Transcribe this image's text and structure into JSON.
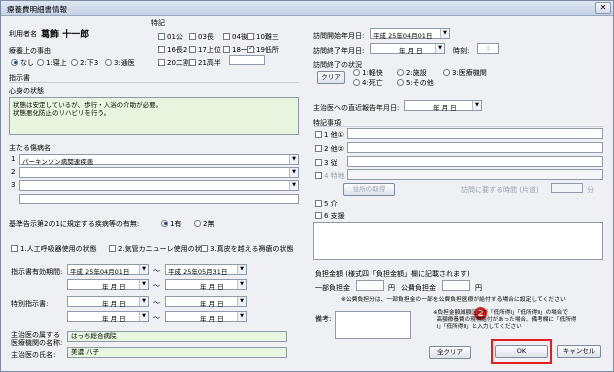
{
  "window": {
    "title": "療養費明細書情報",
    "close_glyph": "✕"
  },
  "patient": {
    "label": "利用者名",
    "name": "葛飾 十一郎"
  },
  "tokki": {
    "label": "特記",
    "items": [
      {
        "label": "01公",
        "checked": false
      },
      {
        "label": "03長",
        "checked": false
      },
      {
        "label": "04後障",
        "checked": false
      },
      {
        "label": "10難三",
        "checked": false
      },
      {
        "label": "16長2",
        "checked": false
      },
      {
        "label": "17上位",
        "checked": false
      },
      {
        "label": "18一般",
        "checked": false
      },
      {
        "label": "19低所",
        "checked": true
      },
      {
        "label": "20二割",
        "checked": false
      },
      {
        "label": "21高半",
        "checked": false
      }
    ]
  },
  "kantai": {
    "label": "療養上の事由",
    "options": [
      "なし",
      "1:寝上",
      "2:下3",
      "3:通医"
    ],
    "selected": 0
  },
  "shijisho": {
    "label": "指示書"
  },
  "shinshin": {
    "label": "心身の状態",
    "text": "状態は安定しているが、歩行・入浴の介助が必要。\n状態悪化防止のリハビリを行う。"
  },
  "byomei": {
    "label": "主たる傷病名",
    "rows": [
      {
        "num": "1",
        "value": "パーキンソン病関連疾患"
      },
      {
        "num": "2",
        "value": ""
      },
      {
        "num": "3",
        "value": ""
      }
    ]
  },
  "kijun": {
    "label": "基準告示第2の1に規定する疾病等の有無:",
    "options": [
      "1有",
      "2無"
    ],
    "selected": 0
  },
  "kiki": [
    {
      "label": "1.人工呼吸器使用の状態",
      "checked": false
    },
    {
      "label": "2.気管カニューレ使用の状態",
      "checked": false
    },
    {
      "label": "3.真皮を越える褥瘡の状態",
      "checked": false
    }
  ],
  "shijikikan": {
    "label": "指示書有効期間:",
    "from": "平成 25年04月01日",
    "to": "平成 25年05月31日",
    "tilde": "〜",
    "ymd": "年   月   日"
  },
  "tokubetsu": {
    "label": "特別指示書:",
    "ymd": "年   月   日",
    "tilde": "〜"
  },
  "iryokikan": {
    "label1": "主治医の属する",
    "label2": "医療機関の名称:",
    "value": "はっち総合病院"
  },
  "ishi": {
    "label": "主治医の氏名:",
    "value": "美濃 八子"
  },
  "homon": {
    "start_label": "訪問開始年月日:",
    "start_value": "平成 25年04月01日",
    "end_label": "訪問終了年月日:",
    "ymd": "年   月   日",
    "time_label": "時刻:",
    "time_value": ":"
  },
  "shuryo": {
    "label": "訪問終了の状況",
    "clear": "クリア",
    "options": [
      "1:軽快",
      "2:施設",
      "3:医療機関",
      "4:死亡",
      "5:その他"
    ]
  },
  "hokoku": {
    "label": "主治医への直近報告年月日:",
    "ymd": "年   月   日"
  },
  "tokkijiko": {
    "label": "特記事項",
    "items": [
      {
        "label": "1 他①",
        "checked": false
      },
      {
        "label": "2 他②",
        "checked": false
      },
      {
        "label": "3 従",
        "checked": false
      },
      {
        "label": "4 特地",
        "checked": false
      },
      {
        "label": "5 介",
        "checked": false
      },
      {
        "label": "6 支援",
        "checked": false
      }
    ],
    "shimin_btn": "住所の取得",
    "jikan_label": "訪問に要する時間 (片道)",
    "jikan_unit": "分"
  },
  "futan": {
    "label": "負担金額 (様式四「負担金額」欄に記載されます)",
    "ichibu": "一部負担金",
    "yen1": "円",
    "kohi": "公費負担金",
    "yen2": "円",
    "note": "※公費負担分は、一部負担金の一部を公費負担医療が給付する場合に設定してください"
  },
  "biko": {
    "label": "備考:",
    "note": "※負担金額減額区分が「低所得Ⅰ」「低所得Ⅱ」の場合で\n  高額療養費の現物給付があった場合、備考欄に「低所得\n  Ⅰ」「低所得Ⅱ」と入力してください",
    "marker": "2"
  },
  "buttons": {
    "all_clear": "全クリア",
    "ok": "OK",
    "cancel": "キャンセル"
  },
  "colors": {
    "highlight": "#e02020",
    "green": "#e8f6df"
  }
}
